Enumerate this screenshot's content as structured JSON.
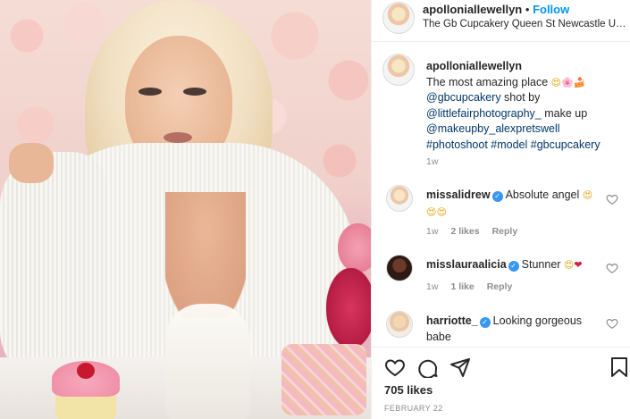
{
  "post": {
    "author": "apolloniallewellyn",
    "dot": "•",
    "follow_label": "Follow",
    "location": "The Gb Cupcakery Queen St Newcastle Upon Tyne",
    "caption": {
      "username": "apolloniallewellyn",
      "text": "The most amazing place",
      "caption_emojis": [
        "😍",
        "🌸",
        "🍰"
      ],
      "mention1": "@gbcupcakery",
      "shot_by": " shot by ",
      "mention2": "@littlefairphotography_",
      "make_up": " make up ",
      "mention3": "@makeupby_alexpretswell",
      "hashtags": "#photoshoot #model #gbcupcakery",
      "time": "1w"
    },
    "comments": [
      {
        "username": "missalidrew",
        "text": "Absolute angel",
        "emojis": [
          "😍",
          "😍",
          "😍"
        ],
        "time": "1w",
        "likes": "2 likes",
        "reply": "Reply"
      },
      {
        "username": "misslauraalicia",
        "text": "Stunner",
        "emojis": [
          "😍",
          "❤"
        ],
        "time": "1w",
        "likes": "1 like",
        "reply": "Reply"
      },
      {
        "username": "harriotte_",
        "text": "Looking gorgeous babe",
        "emojis": []
      }
    ],
    "likes": "705 likes",
    "date": "FEBRUARY 22",
    "verified_glyph": "✓"
  },
  "icons": {
    "like": "heart-icon",
    "comment": "comment-icon",
    "share": "share-icon",
    "save": "bookmark-icon",
    "comment_like": "heart-outline-icon"
  },
  "colors": {
    "link": "#00376b",
    "follow": "#0095f6",
    "verified": "#3897f0",
    "muted": "#8e8e8e"
  }
}
